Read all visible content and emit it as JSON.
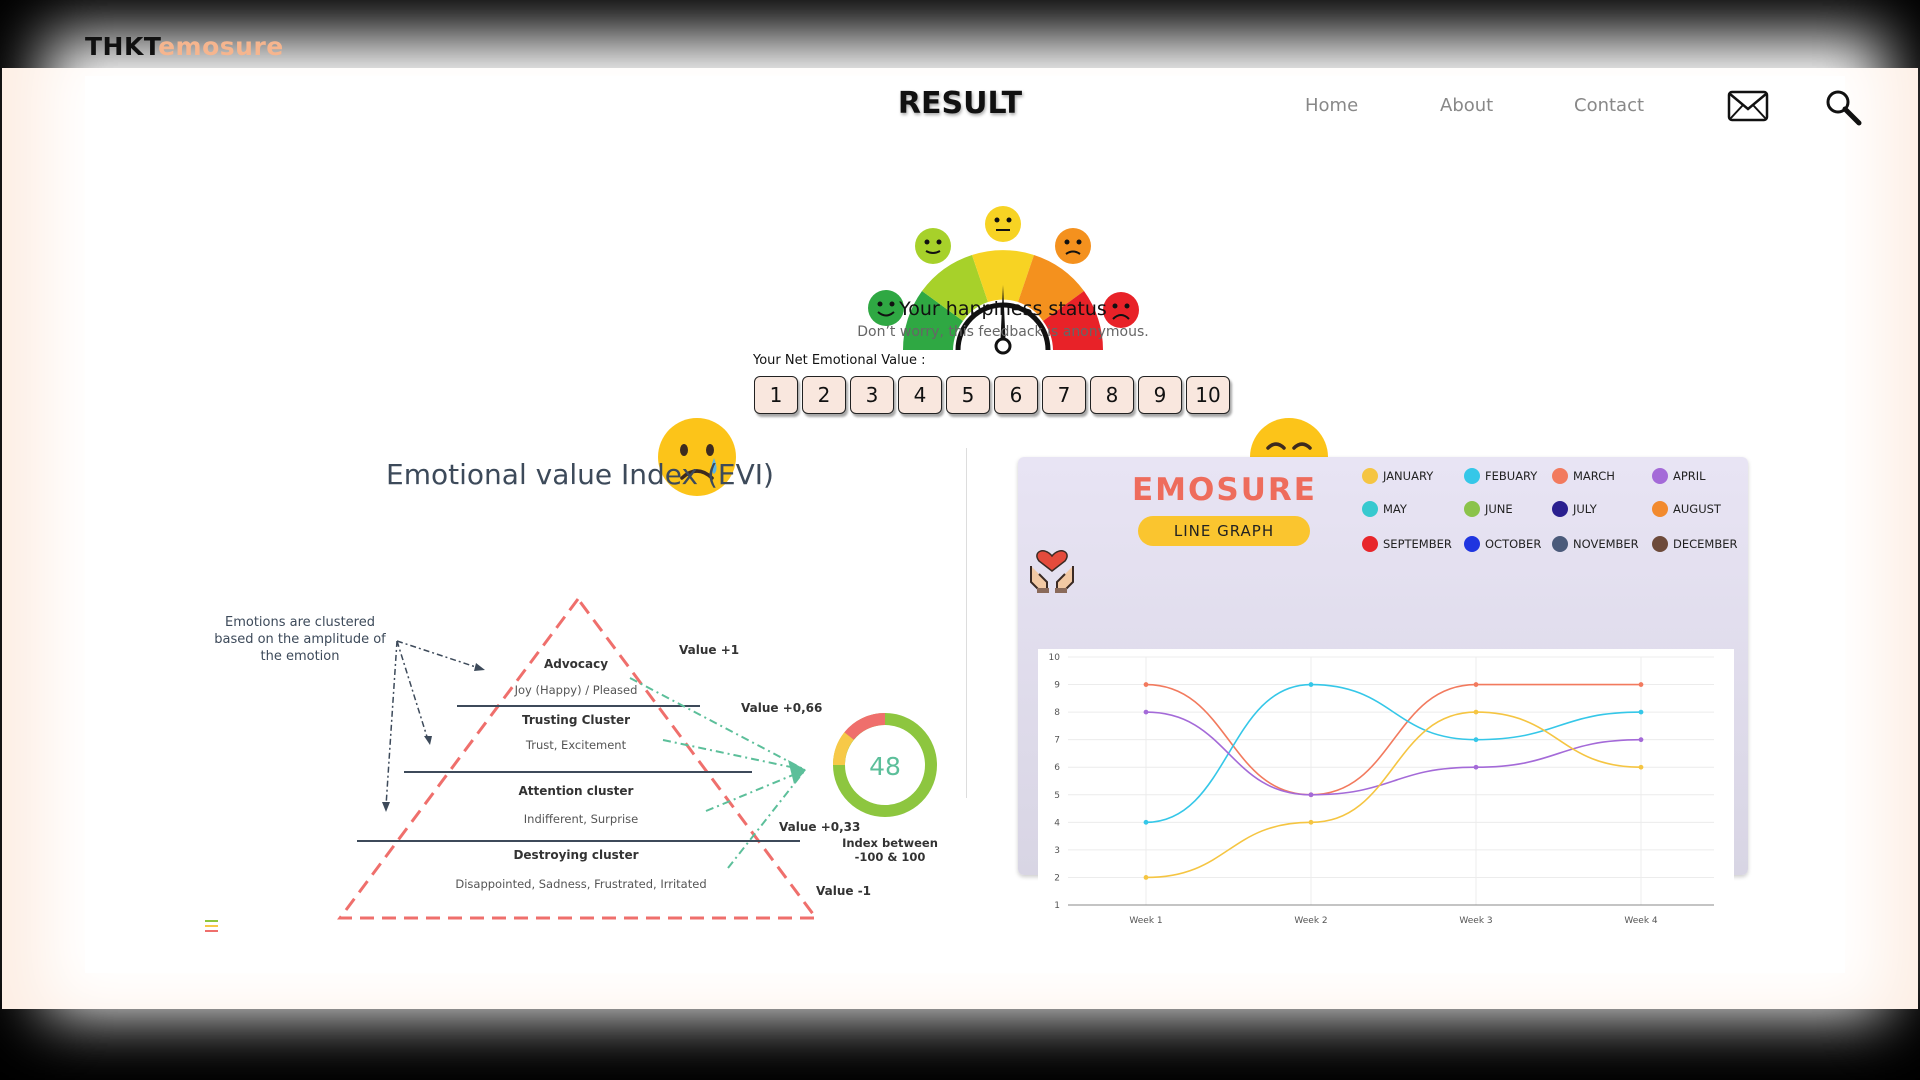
{
  "header": {
    "logo_part1": "THKT",
    "logo_part2": "emosure",
    "nav": [
      "Home",
      "About",
      "Contact"
    ]
  },
  "result": {
    "title": "RESULT",
    "status_title": "Your happiness status",
    "status_subtitle": "Don’t worry, this feedback is anonymous.",
    "nev_label": "Your Net Emotional Value :",
    "scale": [
      "1",
      "2",
      "3",
      "4",
      "5",
      "6",
      "7",
      "8",
      "9",
      "10"
    ]
  },
  "evi": {
    "title": "Emotional value Index (EVI)",
    "note_line1": "Emotions are clustered",
    "note_line2": "based on the amplitude of",
    "note_line3": "the emotion",
    "clusters": [
      {
        "name": "Advocacy",
        "emotions": "Joy (Happy) / Pleased"
      },
      {
        "name": "Trusting Cluster",
        "emotions": "Trust, Excitement"
      },
      {
        "name": "Attention cluster",
        "emotions": "Indifferent, Surprise"
      },
      {
        "name": "Destroying cluster",
        "emotions": "Disappointed, Sadness, Frustrated, Irritated"
      }
    ],
    "values": [
      "Value +1",
      "Value +0,66",
      "Value +0,33",
      "Value -1"
    ],
    "index_value": "48",
    "index_note_line1": "Index between",
    "index_note_line2": "-100 & 100"
  },
  "graph": {
    "brand": "EMOSURE",
    "pill": "LINE GRAPH",
    "legend": [
      {
        "label": "JANUARY",
        "color": "#f5c542"
      },
      {
        "label": "FEBUARY",
        "color": "#35c7e8"
      },
      {
        "label": "MARCH",
        "color": "#f27a5e"
      },
      {
        "label": "APRIL",
        "color": "#a46ad8"
      },
      {
        "label": "MAY",
        "color": "#37c9cf"
      },
      {
        "label": "JUNE",
        "color": "#8bc34a"
      },
      {
        "label": "JULY",
        "color": "#2a1f8f"
      },
      {
        "label": "AUGUST",
        "color": "#f28a2e"
      },
      {
        "label": "SEPTEMBER",
        "color": "#e8262b"
      },
      {
        "label": "OCTOBER",
        "color": "#1f35e0"
      },
      {
        "label": "NOVEMBER",
        "color": "#4a5a7a"
      },
      {
        "label": "DECEMBER",
        "color": "#6d4a3a"
      }
    ]
  },
  "chart_data": {
    "type": "line",
    "categories": [
      "Week 1",
      "Week 2",
      "Week 3",
      "Week 4"
    ],
    "ylim": [
      1,
      10
    ],
    "yticks": [
      "1",
      "2",
      "3",
      "4",
      "5",
      "6",
      "7",
      "8",
      "9",
      "10"
    ],
    "series": [
      {
        "color": "#f27a5e",
        "values": [
          9,
          5,
          9,
          9
        ]
      },
      {
        "color": "#35c7e8",
        "values": [
          4,
          9,
          7,
          8
        ]
      },
      {
        "color": "#a46ad8",
        "values": [
          8,
          5,
          6,
          7
        ]
      },
      {
        "color": "#f5c542",
        "values": [
          2,
          4,
          8,
          6
        ]
      }
    ]
  },
  "gauge": {
    "needle_position": "center"
  }
}
